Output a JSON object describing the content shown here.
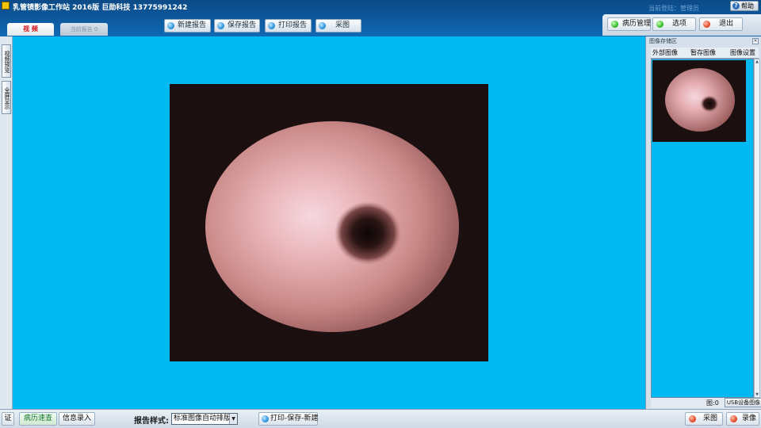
{
  "app": {
    "title": "乳管镜影像工作站  2016版   巨勋科技   13775991242",
    "login_info": "当前登陆：管理员",
    "help_label": "帮助",
    "help_icon": "question-icon"
  },
  "tabs": {
    "video": "视 频",
    "current_report": "当前报告 0"
  },
  "toolbar": {
    "new_report": "新建报告",
    "save_report": "保存报告",
    "print_report": "打印报告",
    "capture": "采图"
  },
  "right_nav": {
    "records": "病历管理",
    "options": "选项",
    "exit": "退出"
  },
  "left_strip": {
    "preview": "视频预览",
    "fullscreen": "全屏显示"
  },
  "image_panel": {
    "title": "图像存储区",
    "tabs": [
      "外部图像",
      "暂存图像",
      "图像设置"
    ],
    "image_count": "图:0",
    "usb_settings": "USB设备图像"
  },
  "bottom": {
    "cert": "证",
    "record_lookup": "病历速查",
    "info_entry": "信息录入",
    "report_style_label": "报告样式:",
    "report_style_value": "标准图像自动排版",
    "print_save_new": "打印-保存-新建",
    "capture": "采图",
    "record_video": "录像"
  },
  "colors": {
    "video_background": "#00b8f2",
    "accent_red": "#d2151a",
    "led_green": "#22b318",
    "led_red": "#e03a16"
  }
}
